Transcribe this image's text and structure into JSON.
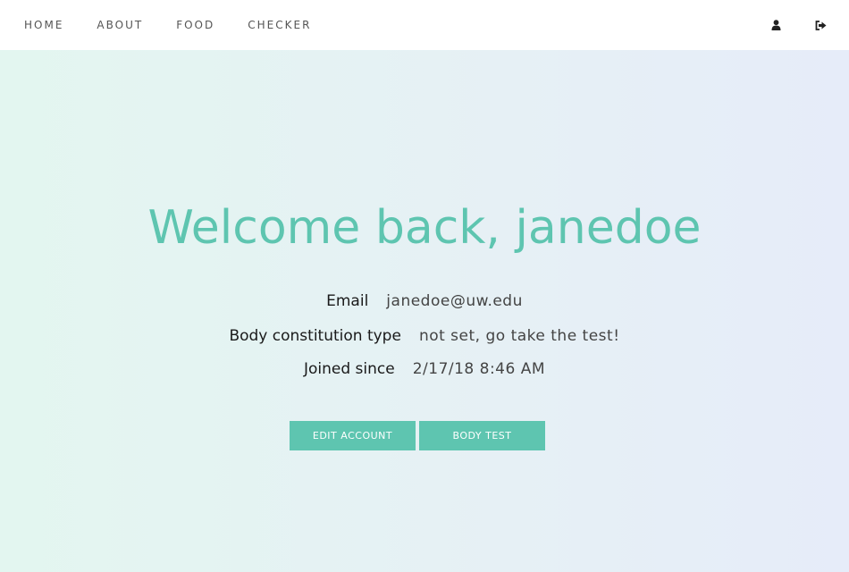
{
  "nav": {
    "items": [
      {
        "label": "HOME"
      },
      {
        "label": "ABOUT"
      },
      {
        "label": "FOOD"
      },
      {
        "label": "CHECKER"
      }
    ],
    "icons": [
      "user-icon",
      "sign-out-icon"
    ]
  },
  "main": {
    "welcome": "Welcome back, janedoe",
    "info": [
      {
        "label": "Email",
        "value": "janedoe@uw.edu"
      },
      {
        "label": "Body constitution type",
        "value": "not set, go take the test!"
      },
      {
        "label": "Joined since",
        "value": "2/17/18 8:46 AM"
      }
    ],
    "buttons": {
      "edit_account": "EDIT ACCOUNT",
      "body_test": "BODY TEST"
    }
  },
  "colors": {
    "accent": "#5ec5b0",
    "nav_text": "#555555",
    "background_start": "#e3f6f0",
    "background_end": "#e6ecf9"
  }
}
